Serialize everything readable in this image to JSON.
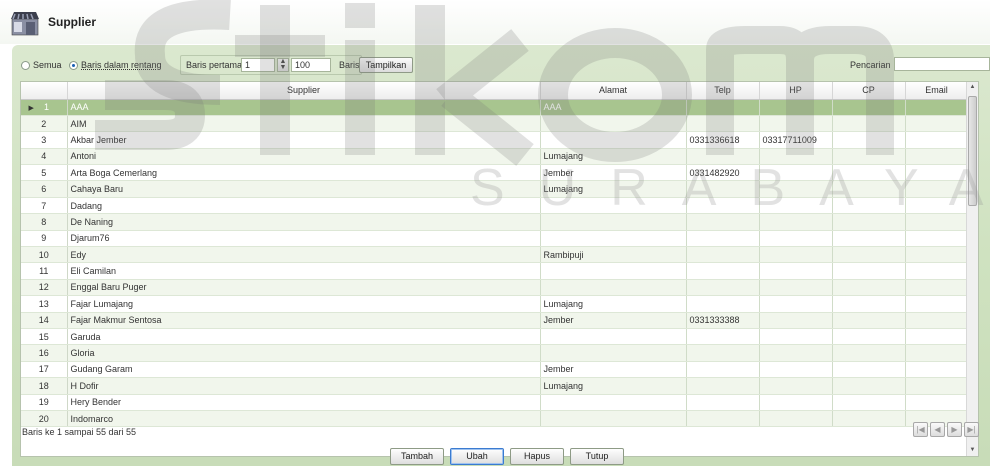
{
  "window": {
    "title": "Supplier"
  },
  "filter": {
    "semua_label": "Semua",
    "rentang_label": "Baris dalam rentang",
    "baris_pertama_label": "Baris pertama",
    "baris_pertama_value": "1",
    "count_value": "100",
    "baris_label": "Baris",
    "tampilkan_label": "Tampilkan",
    "pencarian_label": "Pencarian",
    "pencarian_value": ""
  },
  "watermark": {
    "main": "Stikom",
    "sub": "SURABAYA"
  },
  "table": {
    "columns": [
      "",
      "Supplier",
      "Alamat",
      "Telp",
      "HP",
      "CP",
      "Email"
    ],
    "rows": [
      {
        "no": "1",
        "supplier": "AAA",
        "alamat": "AAA",
        "telp": "",
        "hp": "",
        "cp": "",
        "email": ""
      },
      {
        "no": "2",
        "supplier": "AIM",
        "alamat": "",
        "telp": "",
        "hp": "",
        "cp": "",
        "email": ""
      },
      {
        "no": "3",
        "supplier": "Akbar Jember",
        "alamat": "",
        "telp": "0331336618",
        "hp": "03317711009",
        "cp": "",
        "email": ""
      },
      {
        "no": "4",
        "supplier": "Antoni",
        "alamat": "Lumajang",
        "telp": "",
        "hp": "",
        "cp": "",
        "email": ""
      },
      {
        "no": "5",
        "supplier": "Arta Boga Cemerlang",
        "alamat": "Jember",
        "telp": "0331482920",
        "hp": "",
        "cp": "",
        "email": ""
      },
      {
        "no": "6",
        "supplier": "Cahaya Baru",
        "alamat": "Lumajang",
        "telp": "",
        "hp": "",
        "cp": "",
        "email": ""
      },
      {
        "no": "7",
        "supplier": "Dadang",
        "alamat": "",
        "telp": "",
        "hp": "",
        "cp": "",
        "email": ""
      },
      {
        "no": "8",
        "supplier": "De Naning",
        "alamat": "",
        "telp": "",
        "hp": "",
        "cp": "",
        "email": ""
      },
      {
        "no": "9",
        "supplier": "Djarum76",
        "alamat": "",
        "telp": "",
        "hp": "",
        "cp": "",
        "email": ""
      },
      {
        "no": "10",
        "supplier": "Edy",
        "alamat": "Rambipuji",
        "telp": "",
        "hp": "",
        "cp": "",
        "email": ""
      },
      {
        "no": "11",
        "supplier": "Eli Camilan",
        "alamat": "",
        "telp": "",
        "hp": "",
        "cp": "",
        "email": ""
      },
      {
        "no": "12",
        "supplier": "Enggal Baru Puger",
        "alamat": "",
        "telp": "",
        "hp": "",
        "cp": "",
        "email": ""
      },
      {
        "no": "13",
        "supplier": "Fajar Lumajang",
        "alamat": "Lumajang",
        "telp": "",
        "hp": "",
        "cp": "",
        "email": ""
      },
      {
        "no": "14",
        "supplier": "Fajar Makmur Sentosa",
        "alamat": "Jember",
        "telp": "0331333388",
        "hp": "",
        "cp": "",
        "email": ""
      },
      {
        "no": "15",
        "supplier": "Garuda",
        "alamat": "",
        "telp": "",
        "hp": "",
        "cp": "",
        "email": ""
      },
      {
        "no": "16",
        "supplier": "Gloria",
        "alamat": "",
        "telp": "",
        "hp": "",
        "cp": "",
        "email": ""
      },
      {
        "no": "17",
        "supplier": "Gudang Garam",
        "alamat": "Jember",
        "telp": "",
        "hp": "",
        "cp": "",
        "email": ""
      },
      {
        "no": "18",
        "supplier": "H Dofir",
        "alamat": "Lumajang",
        "telp": "",
        "hp": "",
        "cp": "",
        "email": ""
      },
      {
        "no": "19",
        "supplier": "Hery Bender",
        "alamat": "",
        "telp": "",
        "hp": "",
        "cp": "",
        "email": ""
      },
      {
        "no": "20",
        "supplier": "Indomarco",
        "alamat": "",
        "telp": "",
        "hp": "",
        "cp": "",
        "email": ""
      }
    ]
  },
  "status": {
    "text": "Baris ke 1 sampai 55 dari 55"
  },
  "nav": {
    "first": "first-icon",
    "prev": "prev-icon",
    "next": "next-icon",
    "last": "last-icon"
  },
  "actions": {
    "tambah": "Tambah",
    "ubah": "Ubah",
    "hapus": "Hapus",
    "tutup": "Tutup"
  },
  "colors": {
    "selected_row": "#a8c58f",
    "panel": "#cfe2c0",
    "alt_row": "#f1f6ec"
  }
}
